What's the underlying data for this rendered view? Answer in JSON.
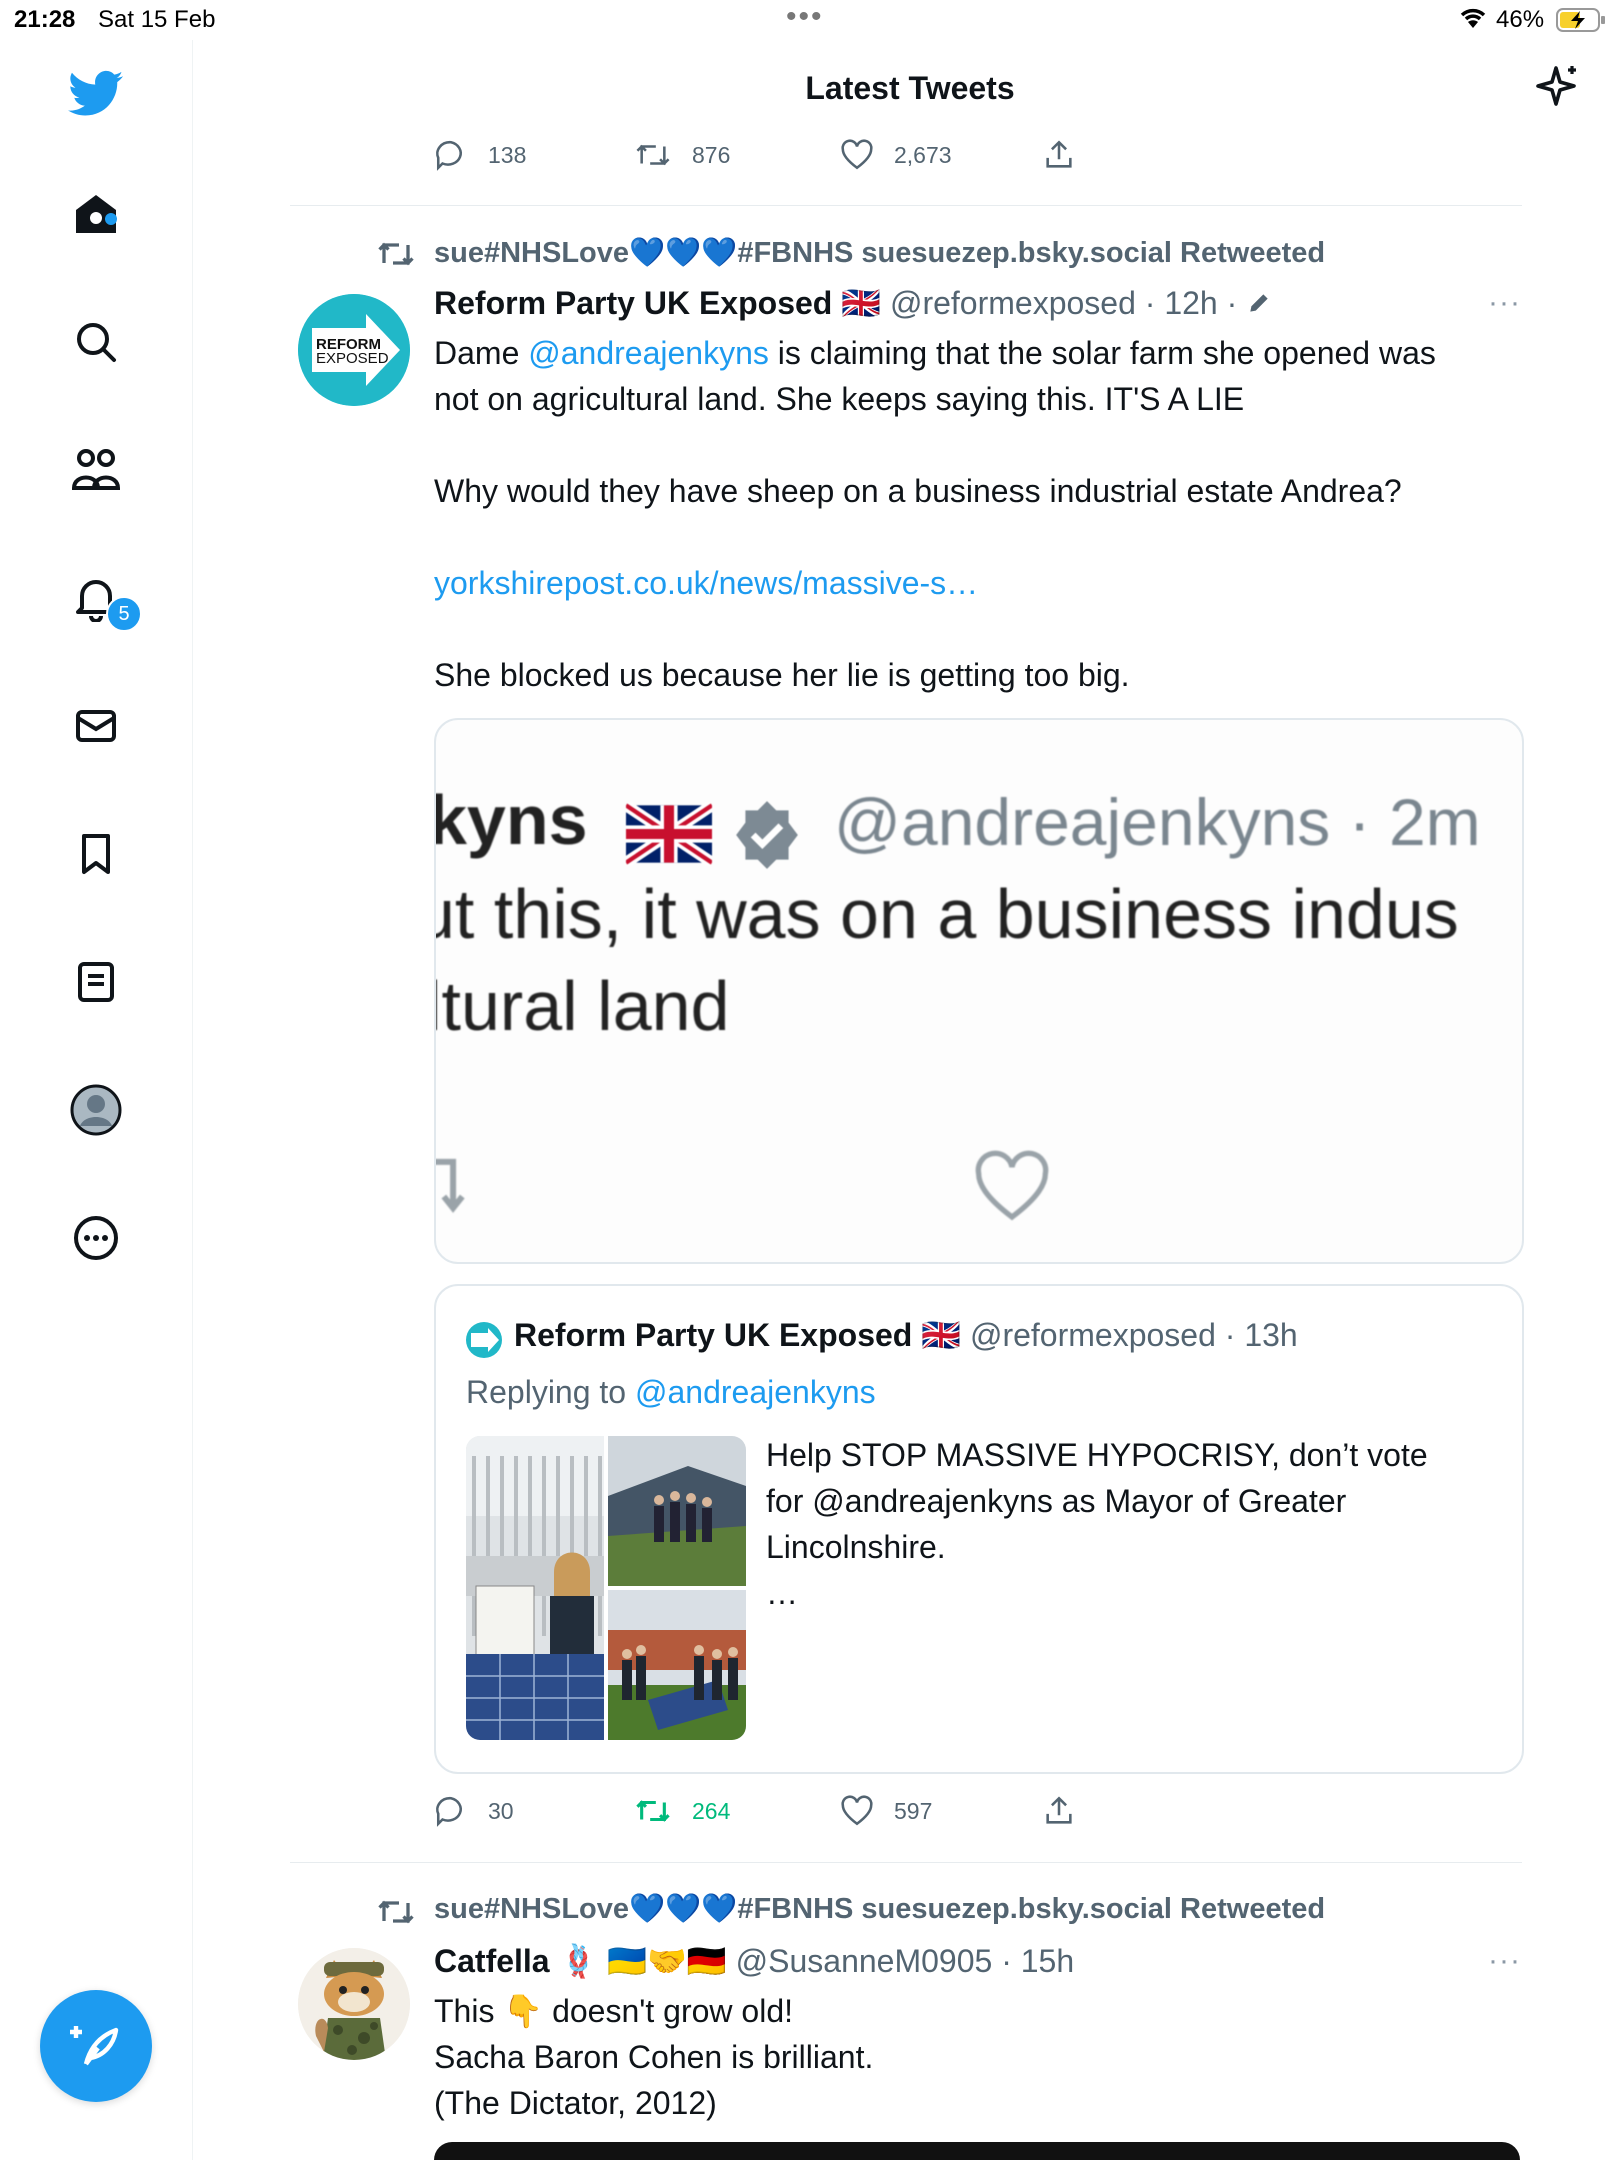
{
  "status_bar": {
    "time": "21:28",
    "date": "Sat 15 Feb",
    "battery": "46%"
  },
  "header": {
    "title": "Latest Tweets"
  },
  "nav": {
    "notifications_count": "5"
  },
  "prev_tweet_actions": {
    "replies": "138",
    "retweets": "876",
    "likes": "2,673"
  },
  "tweet1": {
    "retweeted_by": "sue#NHSLove💙💙💙#FBNHS suesuezep.bsky.social Retweeted",
    "name": "Reform Party UK Exposed",
    "flag": "🇬🇧",
    "meta": "@reformexposed · 12h ·",
    "more": "···",
    "avatar_text_1": "REFORM",
    "avatar_text_2": "EXPOSED",
    "text_prefix": "Dame ",
    "mention": "@andreajenkyns",
    "text_line1_rest": " is claiming that the solar farm she opened was",
    "text_line2": "not on agricultural land. She keeps saying this. IT'S A LIE",
    "text_para2": "Why would they have sheep on a business industrial estate Andrea?",
    "link": "yorkshirepost.co.uk/news/massive-s…",
    "text_para4": "She blocked us because her lie is getting too big.",
    "media": {
      "line1_name": "kyns",
      "line1_handle": "@andreajenkyns · 2m",
      "line2": "ut this, it was on a business indus",
      "line3": "ltural land"
    },
    "quote": {
      "name": "Reform Party UK Exposed",
      "flag": "🇬🇧",
      "meta": "@reformexposed · 13h",
      "replying_label": "Replying to ",
      "replying_handle": "@andreajenkyns",
      "text_line1": "Help STOP MASSIVE HYPOCRISY, don’t vote",
      "text_line2": "for @andreajenkyns as Mayor of Greater",
      "text_line3": "Lincolnshire.",
      "ellipsis": "…"
    },
    "actions": {
      "replies": "30",
      "retweets": "264",
      "likes": "597"
    }
  },
  "tweet2": {
    "retweeted_by": "sue#NHSLove💙💙💙#FBNHS suesuezep.bsky.social Retweeted",
    "name": "Catfella",
    "emojis": "🪢 🇺🇦🤝🇩🇪",
    "meta": "@SusanneM0905 · 15h",
    "more": "···",
    "text_line1_a": "This ",
    "text_emoji": "👇",
    "text_line1_b": " doesn't grow old!",
    "text_line2": "Sacha Baron Cohen is brilliant.",
    "text_line3": "(The Dictator, 2012)"
  },
  "colors": {
    "accent": "#1d9bf0",
    "retweet_green": "#00ba7c",
    "secondary_text": "#536471"
  }
}
